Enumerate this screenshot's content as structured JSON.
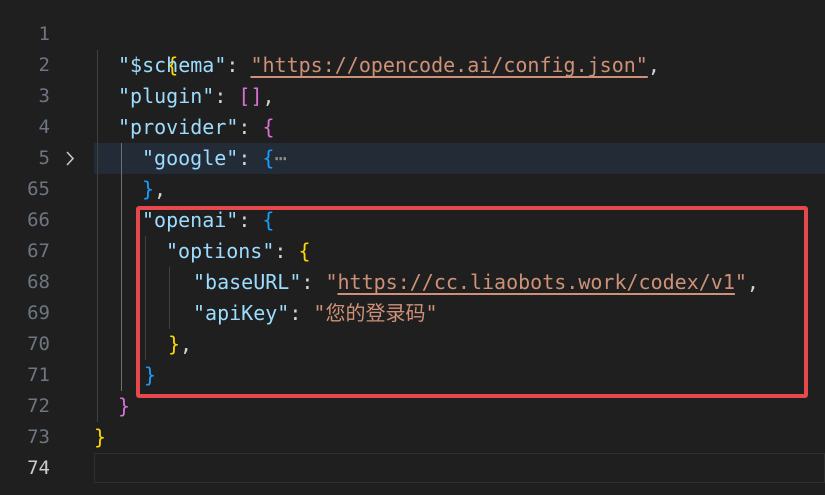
{
  "editor": {
    "colors": {
      "background": "#1f1f1f",
      "key": "#9cdcfe",
      "string": "#ce9178",
      "bracket_level1": "#ffd700",
      "bracket_level2": "#da70d6",
      "bracket_level3": "#179fff",
      "annotation_box": "#e5484d"
    },
    "fold_icon": "chevron-right-icon",
    "line_numbers": [
      "1",
      "2",
      "3",
      "4",
      "5",
      "65",
      "66",
      "67",
      "68",
      "69",
      "70",
      "71",
      "72",
      "73",
      "74"
    ],
    "current_line": "74",
    "lines": {
      "l1_open": "{",
      "l2_key": "\"$schema\"",
      "l2_colon": ": ",
      "l2_value": "\"https://opencode.ai/config.json\"",
      "l2_comma": ",",
      "l3_key": "\"plugin\"",
      "l3_colon": ": ",
      "l3_value": "[]",
      "l3_comma": ",",
      "l4_key": "\"provider\"",
      "l4_colon": ": ",
      "l4_open": "{",
      "l5_key": "\"google\"",
      "l5_colon": ": ",
      "l5_open": "{",
      "l5_ellipsis": "⋯",
      "l65_close": "}",
      "l65_comma": ",",
      "l66_key": "\"openai\"",
      "l66_colon": ": ",
      "l66_open": "{",
      "l67_key": "\"options\"",
      "l67_colon": ": ",
      "l67_open": "{",
      "l68_key": "\"baseURL\"",
      "l68_colon": ": ",
      "l68_quote_open": "\"",
      "l68_url": "https://cc.liaobots.work/codex/v1",
      "l68_quote_close": "\"",
      "l68_comma": ",",
      "l69_key": "\"apiKey\"",
      "l69_colon": ": ",
      "l69_value": "\"您的登录码\"",
      "l70_close": "}",
      "l70_comma": ",",
      "l71_close": "}",
      "l72_close": "}",
      "l73_close": "}"
    }
  }
}
